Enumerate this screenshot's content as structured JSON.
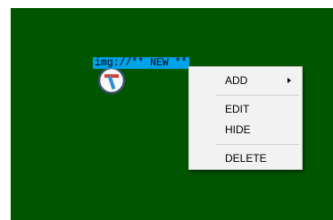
{
  "desktop": {
    "background_color": "#005500",
    "shortcut": {
      "label": "img://** NEW **",
      "label_highlight_color": "#00a2e8",
      "icon": "tool-icon"
    }
  },
  "context_menu": {
    "items": [
      {
        "label": "ADD",
        "has_submenu": true
      },
      {
        "label": "EDIT"
      },
      {
        "label": "HIDE"
      },
      {
        "label": "DELETE"
      }
    ]
  }
}
